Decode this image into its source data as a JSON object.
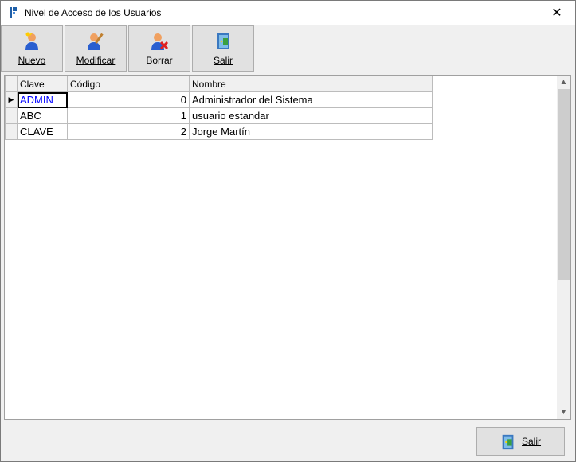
{
  "window": {
    "title": "Nivel de Acceso de los Usuarios",
    "close_glyph": "✕"
  },
  "toolbar": {
    "buttons": [
      {
        "label": "Nuevo",
        "icon": "new-user-icon"
      },
      {
        "label": "Modificar",
        "icon": "edit-user-icon"
      },
      {
        "label": "Borrar",
        "icon": "delete-user-icon"
      },
      {
        "label": "Salir",
        "icon": "exit-door-icon"
      }
    ]
  },
  "grid": {
    "columns": [
      "Clave",
      "Código",
      "Nombre"
    ],
    "rows": [
      {
        "clave": "ADMIN",
        "codigo": "0",
        "nombre": "Administrador del Sistema"
      },
      {
        "clave": "ABC",
        "codigo": "1",
        "nombre": "usuario estandar"
      },
      {
        "clave": "CLAVE",
        "codigo": "2",
        "nombre": "Jorge Martín"
      }
    ],
    "current_row_indicator": "▶"
  },
  "footer": {
    "exit_label": "Salir"
  },
  "colors": {
    "selected_text": "#0000ff",
    "background": "#f0f0f0"
  }
}
